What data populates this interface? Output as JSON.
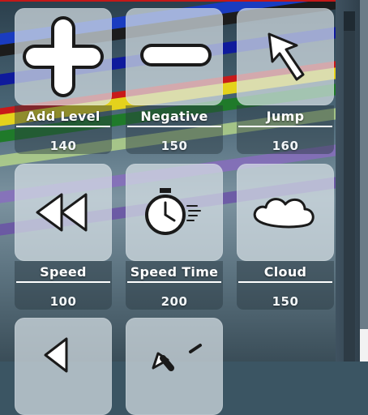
{
  "shop": {
    "items": [
      {
        "name": "Add Level",
        "cost": "140",
        "icon": "plus-icon"
      },
      {
        "name": "Negative",
        "cost": "150",
        "icon": "minus-icon"
      },
      {
        "name": "Jump",
        "cost": "160",
        "icon": "arrow-up-left-icon"
      },
      {
        "name": "Speed",
        "cost": "100",
        "icon": "rewind-icon"
      },
      {
        "name": "Speed Time",
        "cost": "200",
        "icon": "stopwatch-icon"
      },
      {
        "name": "Cloud",
        "cost": "150",
        "icon": "cloud-icon"
      },
      {
        "name": "",
        "cost": "",
        "icon": "arrow-left-icon"
      },
      {
        "name": "",
        "cost": "",
        "icon": "arrow-up-right-icon"
      }
    ]
  },
  "colors": {
    "tile": "#d7e1e6",
    "label": "#ffffff"
  }
}
